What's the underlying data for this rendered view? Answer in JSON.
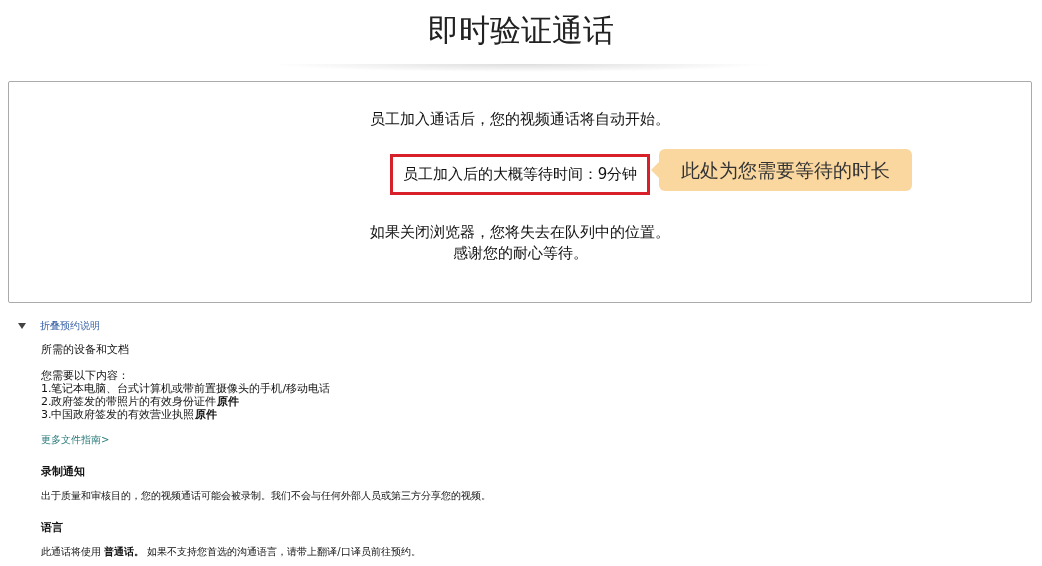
{
  "title": "即时验证通话",
  "status_card": {
    "intro": "员工加入通话后，您的视频通话将自动开始。",
    "wait_time": "员工加入后的大概等待时间：9分钟",
    "callout": "此处为您需要等待的时长",
    "warning": "如果关闭浏览器，您将失去在队列中的位置。",
    "thanks": "感谢您的耐心等待。"
  },
  "details": {
    "toggle": {
      "label": "折叠预约说明",
      "expanded": true
    },
    "heading": "所需的设备和文档",
    "lines": [
      "您需要以下内容：",
      "1.笔记本电脑、台式计算机或带前置摄像头的手机/移动电话",
      "2.政府签发的带照片的有效身份证件**原件**",
      "3.中国政府签发的有效营业执照**原件**"
    ],
    "link": "更多文件指南>"
  },
  "sections": [
    {
      "heading": "录制通知",
      "text": "出于质量和审核目的，您的视频通话可能会被录制。我们不会与任何外部人员或第三方分享您的视频。"
    },
    {
      "heading": "语言",
      "text": "此通话将使用 **普通话。** 如果不支持您首选的沟通语言，请带上翻译/口译员前往预约。"
    }
  ]
}
